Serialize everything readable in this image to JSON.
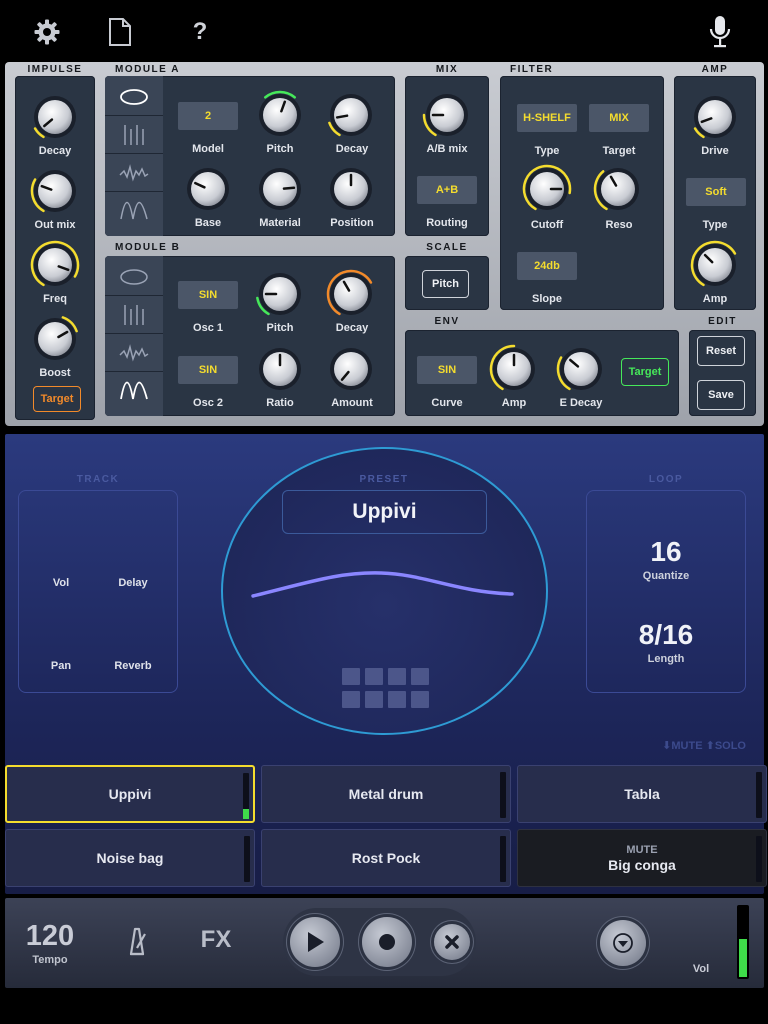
{
  "colors": {
    "accent_yellow": "#f4dc2e",
    "accent_orange": "#f28a2a",
    "accent_green": "#46e85a",
    "ring_blue": "#2e9bd4",
    "wave_purple": "#8a86ff"
  },
  "topbar": {
    "settings_icon": "gear-icon",
    "file_icon": "document-icon",
    "help_label": "?",
    "mic_icon": "microphone-icon"
  },
  "impulse": {
    "title": "IMPULSE",
    "decay": "Decay",
    "outmix": "Out mix",
    "freq": "Freq",
    "boost": "Boost",
    "target": "Target"
  },
  "module_a": {
    "title": "MODULE A",
    "model_value": "2",
    "model": "Model",
    "pitch": "Pitch",
    "decay": "Decay",
    "base": "Base",
    "material": "Material",
    "position": "Position"
  },
  "module_b": {
    "title": "MODULE B",
    "osc1_value": "SIN",
    "osc1": "Osc 1",
    "pitch": "Pitch",
    "decay": "Decay",
    "osc2_value": "SIN",
    "osc2": "Osc 2",
    "ratio": "Ratio",
    "amount": "Amount"
  },
  "mix": {
    "title": "MIX",
    "ab": "A/B mix",
    "routing_value": "A+B",
    "routing": "Routing"
  },
  "scale": {
    "title": "SCALE",
    "pitch": "Pitch"
  },
  "filter": {
    "title": "FILTER",
    "type_value": "H-SHELF",
    "type": "Type",
    "target_value": "MIX",
    "target": "Target",
    "cutoff": "Cutoff",
    "reso": "Reso",
    "slope_value": "24db",
    "slope": "Slope"
  },
  "amp": {
    "title": "AMP",
    "drive": "Drive",
    "type_value": "Soft",
    "type": "Type",
    "amp": "Amp"
  },
  "env": {
    "title": "ENV",
    "curve_value": "SIN",
    "curve": "Curve",
    "amp": "Amp",
    "edecay": "E Decay",
    "target": "Target"
  },
  "edit": {
    "title": "EDIT",
    "reset": "Reset",
    "save": "Save"
  },
  "track": {
    "title": "TRACK",
    "vol": "Vol",
    "delay": "Delay",
    "pan": "Pan",
    "reverb": "Reverb"
  },
  "preset": {
    "title": "PRESET",
    "name": "Uppivi"
  },
  "loop": {
    "title": "LOOP",
    "quantize_value": "16",
    "quantize": "Quantize",
    "length_value": "8/16",
    "length": "Length"
  },
  "mute_solo": "⬇MUTE ⬆SOLO",
  "pads": [
    {
      "name": "Uppivi",
      "mute": ""
    },
    {
      "name": "Metal drum",
      "mute": ""
    },
    {
      "name": "Tabla",
      "mute": ""
    },
    {
      "name": "Noise bag",
      "mute": ""
    },
    {
      "name": "Rost Pock",
      "mute": ""
    },
    {
      "name": "Big conga",
      "mute": "MUTE"
    }
  ],
  "transport": {
    "tempo_value": "120",
    "tempo": "Tempo",
    "metronome_icon": "metronome-icon",
    "fx": "FX",
    "play_icon": "play-icon",
    "record_icon": "record-icon",
    "stop_icon": "close-icon",
    "down_icon": "chevron-down-icon",
    "vol": "Vol",
    "level": 0.55
  }
}
